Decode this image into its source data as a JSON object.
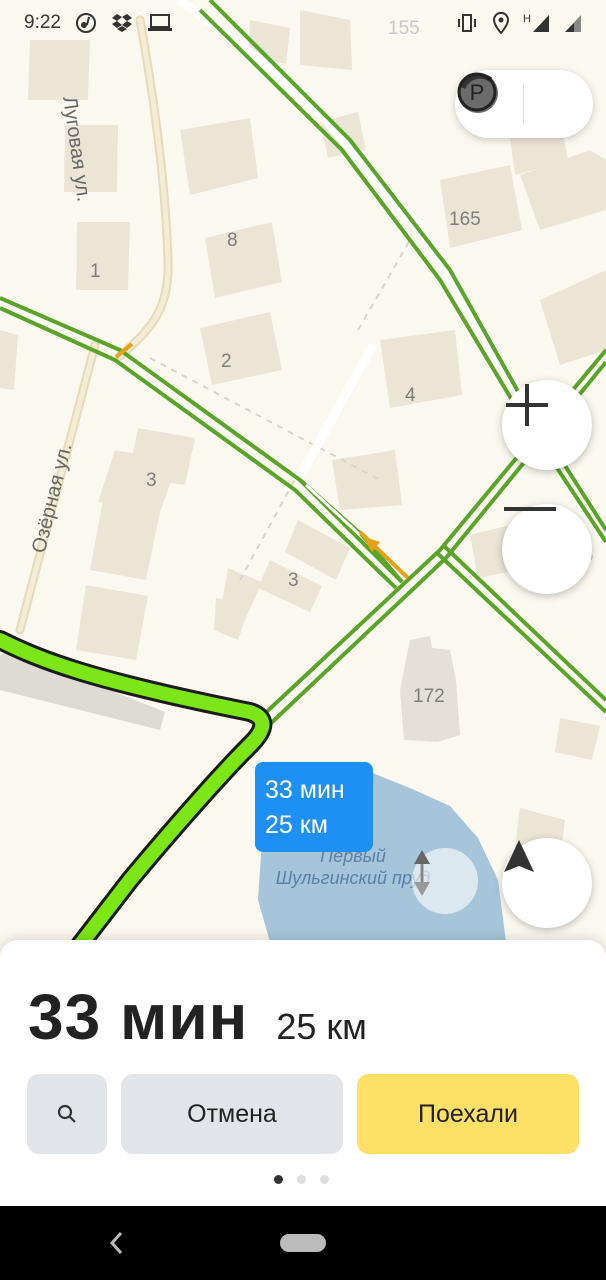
{
  "status_bar": {
    "time": "9:22",
    "signal_label": "H",
    "icons": [
      "music-note-icon",
      "dropbox-icon",
      "laptop-icon",
      "vibrate-icon",
      "location-icon",
      "signal-icon",
      "cellular-icon"
    ]
  },
  "map": {
    "streets": {
      "lugovaya": "Луговая ул.",
      "ozernaya": "Озёрная ул."
    },
    "buildings": {
      "b155": "155",
      "b165": "165",
      "b8": "8",
      "b1": "1",
      "b2": "2",
      "b4": "4",
      "b3a": "3",
      "b3b": "3",
      "b172": "172",
      "b165b": "165"
    },
    "pond": {
      "line1": "Первый",
      "line2": "Шульгинский пруд"
    },
    "route_bubble": {
      "time": "33 мин",
      "distance": "25 км"
    },
    "colors": {
      "route": "#7ce617",
      "road_traffic": "#5aa42a",
      "water": "#a7c5da",
      "bubble": "#1e90f5"
    }
  },
  "controls": {
    "layers_icon": "traffic-layer-icon",
    "parking_label": "P",
    "zoom_in_icon": "plus-icon",
    "zoom_out_icon": "minus-icon",
    "compass_icon": "compass-icon",
    "locate_icon": "navigation-arrow-icon"
  },
  "panel": {
    "eta_time": "33 мин",
    "eta_distance": "25 км",
    "search_icon": "search-icon",
    "cancel_label": "Отмена",
    "go_label": "Поехали",
    "page_dots": 3,
    "active_dot": 0
  }
}
